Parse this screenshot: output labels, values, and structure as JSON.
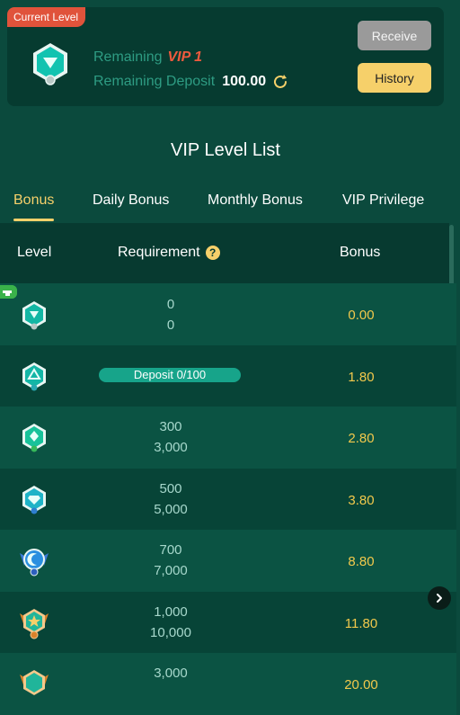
{
  "current_card": {
    "tag": "Current Level",
    "remaining_label": "Remaining",
    "remaining_vip": "VIP 1",
    "remaining_deposit_label": "Remaining Deposit",
    "remaining_deposit_value": "100.00",
    "receive_label": "Receive",
    "history_label": "History"
  },
  "list_title": "VIP Level List",
  "tabs": [
    {
      "label": "Bonus",
      "active": true
    },
    {
      "label": "Daily Bonus",
      "active": false
    },
    {
      "label": "Monthly Bonus",
      "active": false
    },
    {
      "label": "VIP Privilege",
      "active": false
    }
  ],
  "table": {
    "headers": {
      "level": "Level",
      "requirement": "Requirement",
      "bonus": "Bonus"
    },
    "rows": [
      {
        "level": "0",
        "req_top": "0",
        "req_bottom": "0",
        "bonus": "0.00"
      },
      {
        "level": "1",
        "progress": "Deposit 0/100",
        "bonus": "1.80"
      },
      {
        "level": "2",
        "req_top": "300",
        "req_bottom": "3,000",
        "bonus": "2.80"
      },
      {
        "level": "3",
        "req_top": "500",
        "req_bottom": "5,000",
        "bonus": "3.80"
      },
      {
        "level": "4",
        "req_top": "700",
        "req_bottom": "7,000",
        "bonus": "8.80"
      },
      {
        "level": "5",
        "req_top": "1,000",
        "req_bottom": "10,000",
        "bonus": "11.80"
      },
      {
        "level": "6",
        "req_top": "3,000",
        "req_bottom": "",
        "bonus": "20.00"
      }
    ]
  },
  "colors": {
    "background": "#0b4a3d",
    "accent_gold": "#f6d06a",
    "bonus_text": "#f2c94c",
    "vip_red": "#ef5a3e",
    "muted_teal": "#2e9c83"
  }
}
